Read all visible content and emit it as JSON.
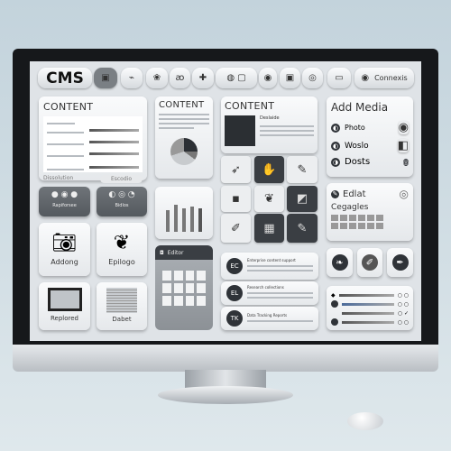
{
  "topbar": {
    "logo": "CMS",
    "icons": [
      "image-icon",
      "code-icon",
      "brain-icon",
      "eg-icon",
      "puzzle-icon",
      "globe-icon",
      "file-icon",
      "circle-icon",
      "save-icon",
      "refresh-icon",
      "window-icon"
    ],
    "connect_label": "Connexis"
  },
  "content_cards": [
    {
      "title": "CONTENT",
      "footer_left": "Dissolution",
      "footer_right": "Escodio"
    },
    {
      "title": "CONTENT"
    },
    {
      "title": "CONTENT",
      "subtitle": "Deslaide"
    }
  ],
  "media": {
    "title": "Add Media",
    "items": [
      "Photo",
      "Woslo",
      "Dosts"
    ]
  },
  "edit": {
    "title": "Edlat",
    "subtitle": "Cegagles"
  },
  "tiles": {
    "small_left": "Rapiforsee",
    "small_right": "Bidlos",
    "camera": "Addong",
    "plant": "Epilogo",
    "replaced": "Replored",
    "doc": "Dabet"
  },
  "grid_header": "Editor",
  "list_items": [
    {
      "badge": "EC",
      "text": "Enterprise content support"
    },
    {
      "badge": "EL",
      "text": "Research collections"
    },
    {
      "badge": "TK",
      "text": "Data Tracking  Reports"
    }
  ],
  "colors": {
    "bezel": "#16181b",
    "screen": "#dfe3e7",
    "dark": "#3a3e43"
  }
}
